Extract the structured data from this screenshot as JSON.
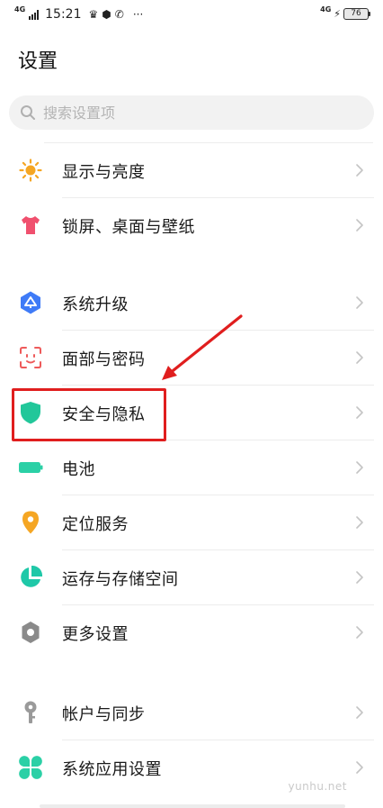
{
  "status_bar": {
    "network_label": "4G",
    "time": "15:21",
    "icons": [
      "crown-icon",
      "shield-hex-icon",
      "phone-icon",
      "more-dots-icon"
    ],
    "more": "···",
    "right_network": "4G",
    "battery_level": "76"
  },
  "page": {
    "title": "设置"
  },
  "search": {
    "placeholder": "搜索设置项"
  },
  "groups": [
    {
      "items": [
        {
          "label": "显示与亮度",
          "icon": "sun-icon",
          "color": "#F5A623"
        },
        {
          "label": "锁屏、桌面与壁纸",
          "icon": "tshirt-icon",
          "color": "#F0506E"
        }
      ]
    },
    {
      "items": [
        {
          "label": "系统升级",
          "icon": "system-update-icon",
          "color": "#3F7BF7"
        },
        {
          "label": "面部与密码",
          "icon": "face-scan-icon",
          "color": "#EE5A5A"
        },
        {
          "label": "安全与隐私",
          "icon": "shield-icon",
          "color": "#22C79A"
        },
        {
          "label": "电池",
          "icon": "battery-icon",
          "color": "#2BD0A6"
        },
        {
          "label": "定位服务",
          "icon": "location-pin-icon",
          "color": "#F5A623"
        },
        {
          "label": "运存与存储空间",
          "icon": "storage-pie-icon",
          "color": "#1FC8A8"
        },
        {
          "label": "更多设置",
          "icon": "gear-icon",
          "color": "#8A8A8A"
        }
      ]
    },
    {
      "items": [
        {
          "label": "帐户与同步",
          "icon": "key-icon",
          "color": "#9A9A9A"
        },
        {
          "label": "系统应用设置",
          "icon": "clover-icon",
          "color": "#2BD0A6"
        }
      ]
    }
  ],
  "annotation": {
    "highlight_color": "#E01E1E"
  },
  "watermark": "yunhu.net"
}
